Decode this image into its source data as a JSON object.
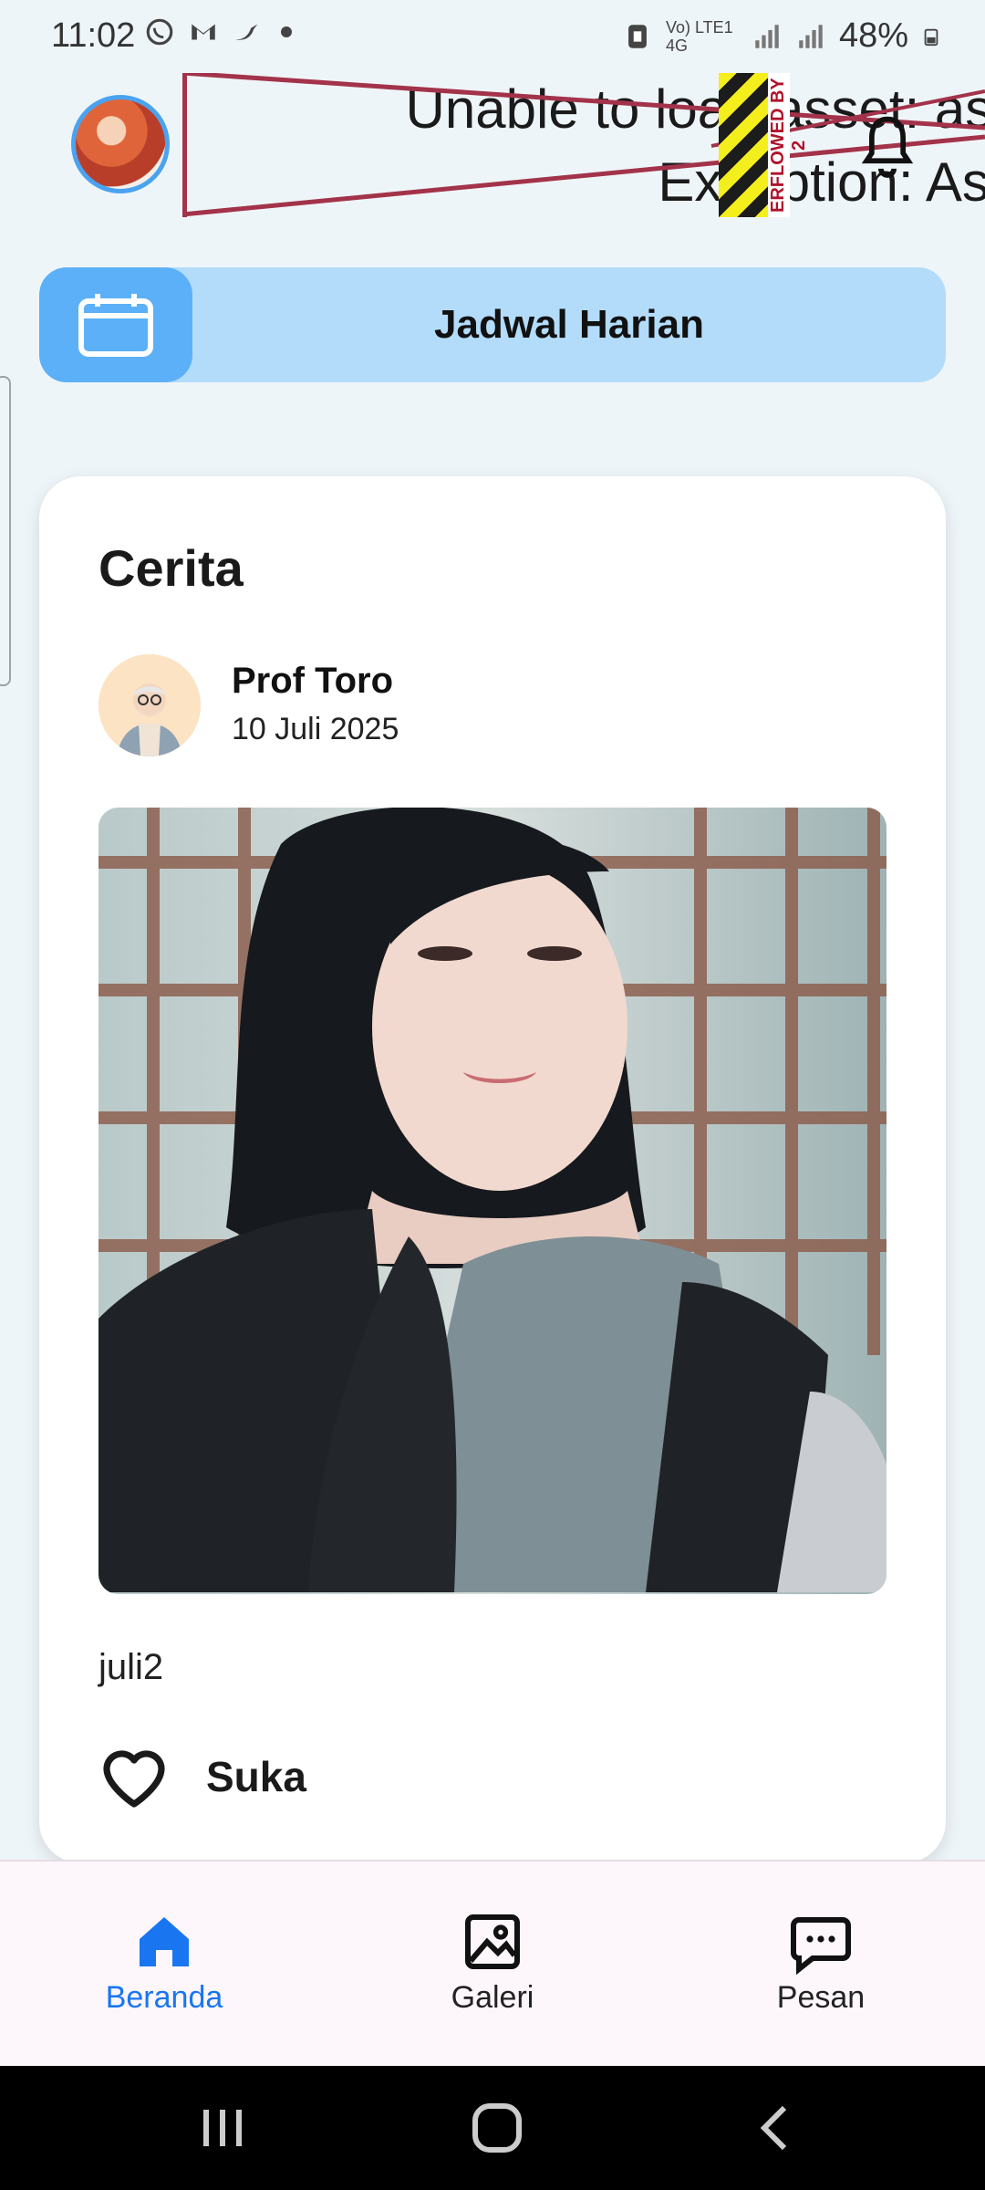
{
  "status_bar": {
    "time": "11:02",
    "left_icons": [
      "whatsapp-icon",
      "gmail-icon",
      "bird-app-icon"
    ],
    "network": "Vo) LTE1 4G",
    "battery": "48%"
  },
  "header": {
    "error_line1": "Unable to load asset: assets/",
    "error_line2": "Exception: Asset n",
    "overflow_label": "ERFLOWED BY 2"
  },
  "schedule": {
    "label": "Jadwal Harian"
  },
  "story": {
    "section_title": "Cerita",
    "author_name": "Prof Toro",
    "date": "10 Juli 2025",
    "caption": "juli2",
    "like_label": "Suka"
  },
  "bottom_nav": {
    "items": [
      {
        "label": "Beranda",
        "icon": "home-icon",
        "active": true
      },
      {
        "label": "Galeri",
        "icon": "gallery-icon",
        "active": false
      },
      {
        "label": "Pesan",
        "icon": "message-icon",
        "active": false
      }
    ]
  },
  "colors": {
    "accent": "#1976f0",
    "schedule_bg": "#b3dcfb",
    "schedule_icon_bg": "#5cb0f7",
    "page_bg": "#eef5f9",
    "error_red": "#a3334a"
  }
}
